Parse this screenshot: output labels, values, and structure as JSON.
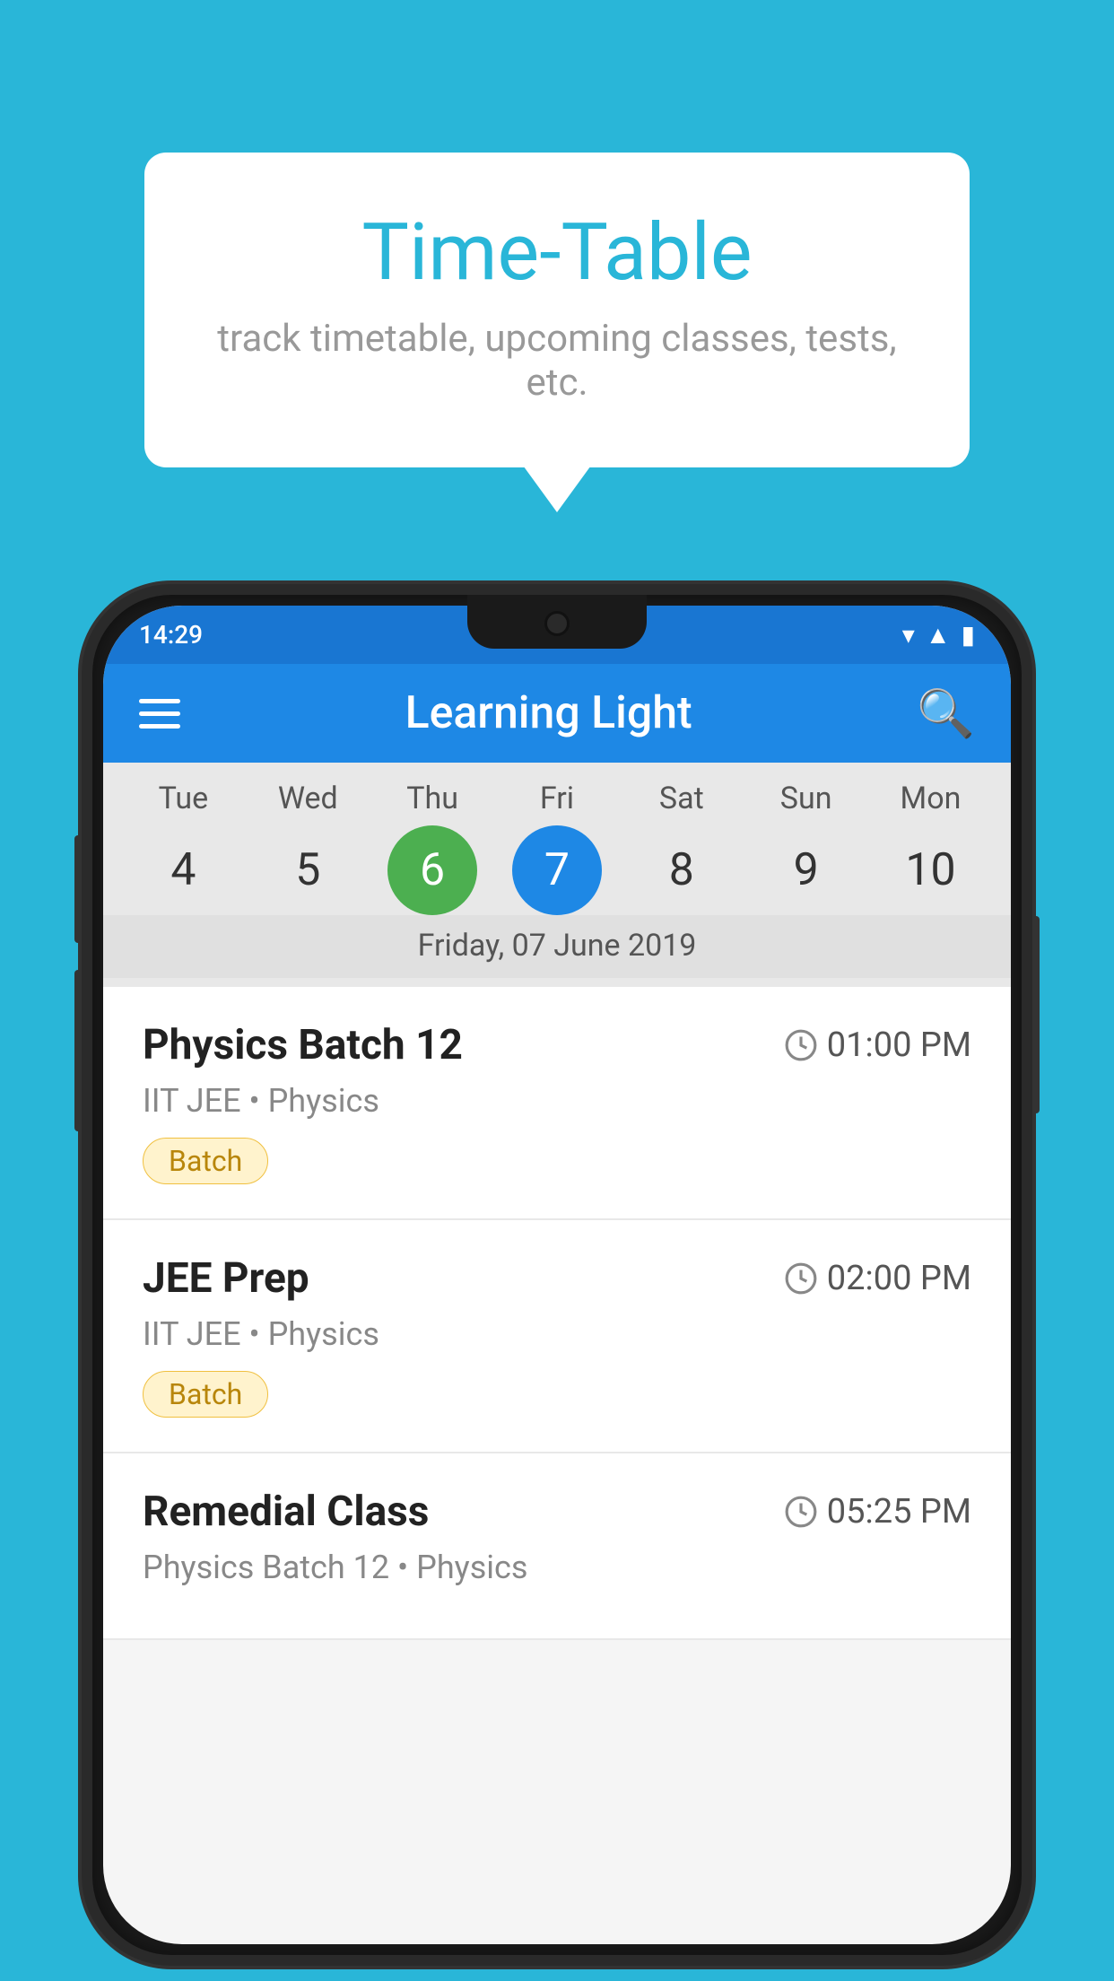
{
  "background_color": "#29b6d8",
  "bubble": {
    "title": "Time-Table",
    "subtitle": "track timetable, upcoming classes, tests, etc."
  },
  "phone": {
    "status_bar": {
      "time": "14:29"
    },
    "toolbar": {
      "title": "Learning Light"
    },
    "calendar": {
      "days": [
        {
          "name": "Tue",
          "number": "4",
          "state": "normal"
        },
        {
          "name": "Wed",
          "number": "5",
          "state": "normal"
        },
        {
          "name": "Thu",
          "number": "6",
          "state": "today"
        },
        {
          "name": "Fri",
          "number": "7",
          "state": "selected"
        },
        {
          "name": "Sat",
          "number": "8",
          "state": "normal"
        },
        {
          "name": "Sun",
          "number": "9",
          "state": "normal"
        },
        {
          "name": "Mon",
          "number": "10",
          "state": "normal"
        }
      ],
      "selected_date_label": "Friday, 07 June 2019"
    },
    "schedule": [
      {
        "title": "Physics Batch 12",
        "time": "01:00 PM",
        "subtitle": "IIT JEE • Physics",
        "tag": "Batch"
      },
      {
        "title": "JEE Prep",
        "time": "02:00 PM",
        "subtitle": "IIT JEE • Physics",
        "tag": "Batch"
      },
      {
        "title": "Remedial Class",
        "time": "05:25 PM",
        "subtitle": "Physics Batch 12 • Physics",
        "tag": ""
      }
    ]
  }
}
